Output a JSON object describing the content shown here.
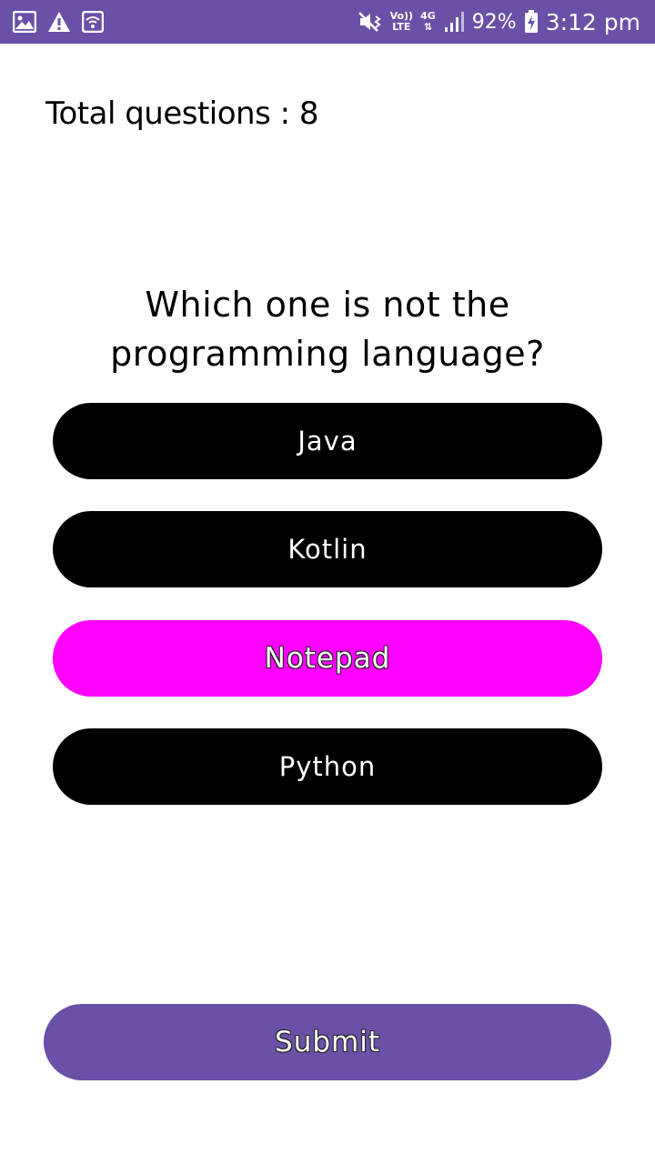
{
  "status_bar": {
    "left_icons": [
      "gallery-icon",
      "warning-icon",
      "wifi-icon"
    ],
    "volte_top": "Vo))",
    "volte_bottom": "LTE",
    "network_type": "4G",
    "battery_percent": "92%",
    "time": "3:12 pm",
    "background_color": "#6a51a7"
  },
  "quiz": {
    "total_label": "Total questions : 8",
    "question": "Which one is not the programming language?",
    "options": [
      {
        "label": "Java",
        "selected": false
      },
      {
        "label": "Kotlin",
        "selected": false
      },
      {
        "label": "Notepad",
        "selected": true
      },
      {
        "label": "Python",
        "selected": false
      }
    ],
    "submit_label": "Submit"
  },
  "colors": {
    "option_default": "#000000",
    "option_selected": "#ff00ff",
    "submit": "#6a51a7",
    "accent": "#6a51a7"
  }
}
